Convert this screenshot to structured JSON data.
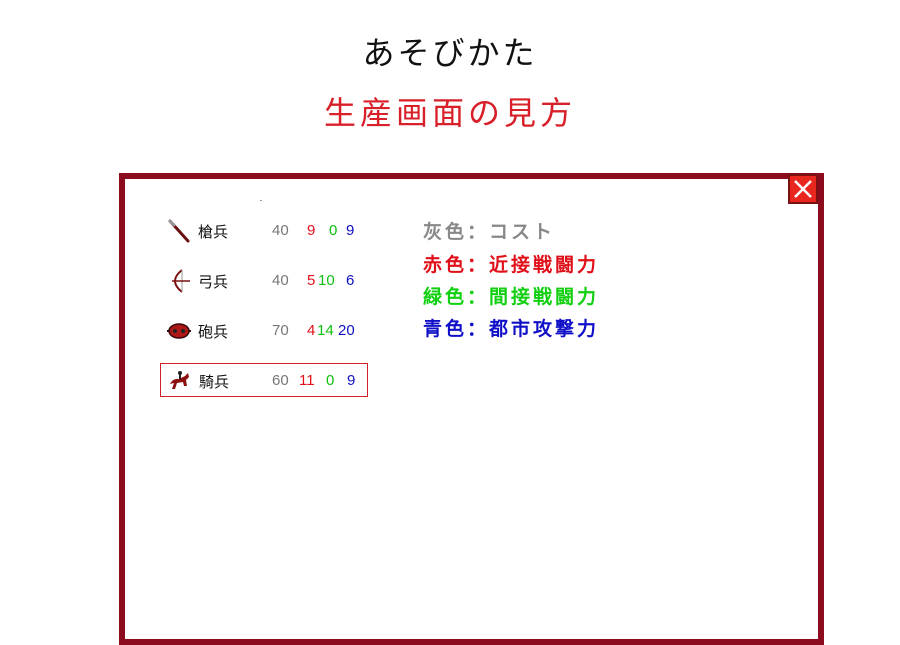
{
  "header": {
    "title": "あそびかた",
    "subtitle": "生産画面の見方"
  },
  "close_button": {
    "icon": "close-icon"
  },
  "units": [
    {
      "icon": "spear-icon",
      "name": "槍兵",
      "cost": "40",
      "melee": "9",
      "ranged": "0",
      "city": "9",
      "selected": false
    },
    {
      "icon": "bow-icon",
      "name": "弓兵",
      "cost": "40",
      "melee": "5",
      "ranged": "10",
      "city": "6",
      "selected": false
    },
    {
      "icon": "cannon-icon",
      "name": "砲兵",
      "cost": "70",
      "melee": "4",
      "ranged": "14",
      "city": "20",
      "selected": false
    },
    {
      "icon": "horse-rider-icon",
      "name": "騎兵",
      "cost": "60",
      "melee": "11",
      "ranged": "0",
      "city": "9",
      "selected": true
    }
  ],
  "legend": {
    "gray": "灰色：コスト",
    "red": "赤色：近接戦闘力",
    "green": "緑色：間接戦闘力",
    "blue": "青色：都市攻撃力"
  },
  "colors": {
    "frame": "#8c0b1c",
    "cost": "#777777",
    "melee": "#e0101a",
    "ranged": "#10c010",
    "city": "#1010c0",
    "subtitle": "#d8202a"
  }
}
